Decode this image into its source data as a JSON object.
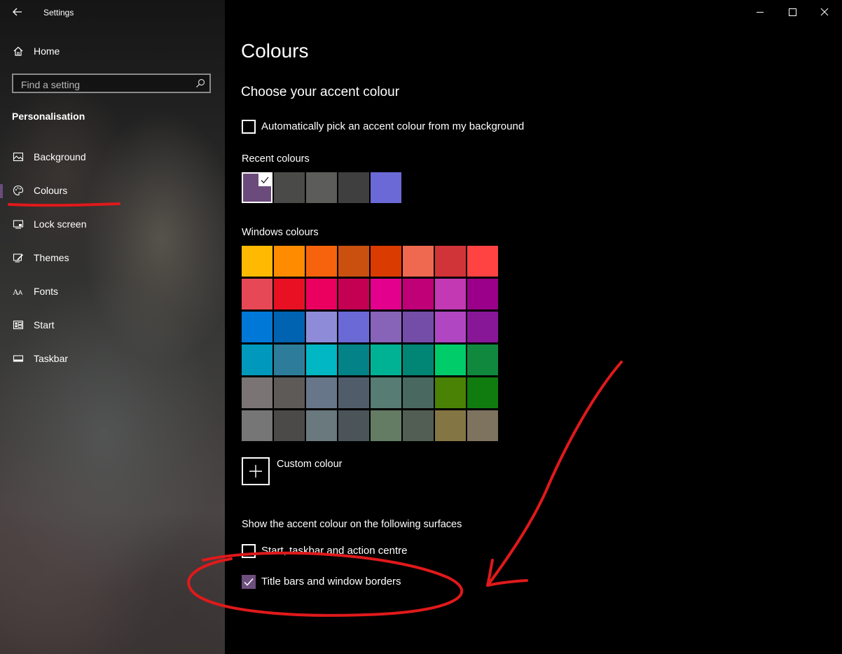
{
  "window": {
    "title": "Settings",
    "controls": [
      "minimize-icon",
      "maximize-icon",
      "close-icon"
    ]
  },
  "sidebar": {
    "home_label": "Home",
    "search_placeholder": "Find a setting",
    "section_title": "Personalisation",
    "items": [
      {
        "label": "Background",
        "icon": "picture-icon",
        "selected": false
      },
      {
        "label": "Colours",
        "icon": "palette-icon",
        "selected": true
      },
      {
        "label": "Lock screen",
        "icon": "lock-screen-icon",
        "selected": false
      },
      {
        "label": "Themes",
        "icon": "themes-icon",
        "selected": false
      },
      {
        "label": "Fonts",
        "icon": "fonts-icon",
        "selected": false
      },
      {
        "label": "Start",
        "icon": "start-icon",
        "selected": false
      },
      {
        "label": "Taskbar",
        "icon": "taskbar-icon",
        "selected": false
      }
    ]
  },
  "main": {
    "title": "Colours",
    "subheading": "Choose your accent colour",
    "auto_pick": {
      "label": "Automatically pick an accent colour from my background",
      "checked": false
    },
    "recent_label": "Recent colours",
    "recent_colours": [
      "#6b4b7c",
      "#4a4a48",
      "#5c5c5a",
      "#3f3f3f",
      "#6b69d6"
    ],
    "recent_selected": 0,
    "windows_label": "Windows colours",
    "windows_colours": [
      [
        "#ffb900",
        "#ff8c00",
        "#f7630c",
        "#ca5010",
        "#da3b01",
        "#ef6950",
        "#d13438",
        "#ff4343"
      ],
      [
        "#e74856",
        "#e81123",
        "#ea005e",
        "#c30052",
        "#e3008c",
        "#bf0077",
        "#c239b3",
        "#9a0089"
      ],
      [
        "#0078d7",
        "#0063b1",
        "#8e8cd8",
        "#6b69d6",
        "#8764b8",
        "#744da9",
        "#b146c2",
        "#881798"
      ],
      [
        "#0099bc",
        "#2d7d9a",
        "#00b7c3",
        "#038387",
        "#00b294",
        "#018574",
        "#00cc6a",
        "#10893e"
      ],
      [
        "#7a7574",
        "#5d5a58",
        "#68768a",
        "#515c6b",
        "#567c73",
        "#486860",
        "#498205",
        "#107c10"
      ],
      [
        "#767676",
        "#4c4a48",
        "#69797e",
        "#4a5459",
        "#647c64",
        "#525e54",
        "#847545",
        "#7e735f"
      ]
    ],
    "custom_label": "Custom colour",
    "surfaces_label": "Show the accent colour on the following surfaces",
    "surfaces": [
      {
        "label": "Start, taskbar and action centre",
        "checked": false
      },
      {
        "label": "Title bars and window borders",
        "checked": true
      }
    ]
  },
  "colors": {
    "accent": "#6b4b7c",
    "annotation": "#e0191b"
  }
}
